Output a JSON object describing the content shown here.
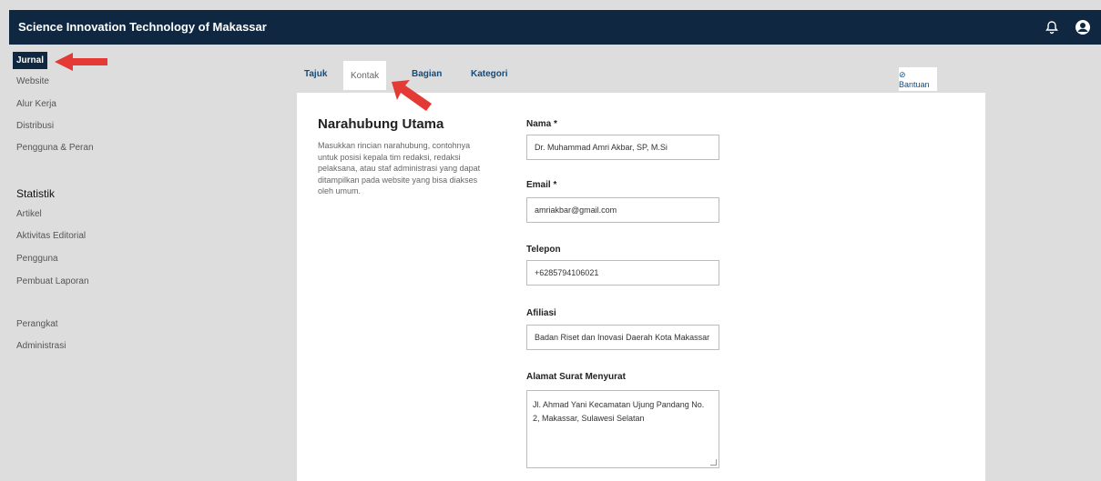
{
  "header": {
    "title": "Science Innovation Technology of Makassar",
    "icons": [
      "bell-icon",
      "user-icon"
    ]
  },
  "sidebar": {
    "items": [
      {
        "label": "Jurnal",
        "active": true
      },
      {
        "label": "Website"
      },
      {
        "label": "Alur Kerja"
      },
      {
        "label": "Distribusi"
      },
      {
        "label": "Pengguna & Peran"
      }
    ],
    "statistik_heading": "Statistik",
    "statistik_items": [
      "Artikel",
      "Aktivitas Editorial",
      "Pengguna",
      "Pembuat Laporan"
    ],
    "bottom_items": [
      "Perangkat",
      "Administrasi"
    ]
  },
  "tabs": [
    {
      "label": "Tajuk"
    },
    {
      "label": "Kontak",
      "active": true
    },
    {
      "label": "Bagian"
    },
    {
      "label": "Kategori"
    }
  ],
  "help_label": "⊘ Bantuan",
  "section": {
    "title": "Narahubung Utama",
    "description": "Masukkan rincian narahubung, contohnya untuk posisi kepala tim redaksi, redaksi pelaksana, atau staf administrasi yang dapat ditampilkan pada website yang bisa diakses oleh umum."
  },
  "fields": {
    "name": {
      "label": "Nama *",
      "value": "Dr. Muhammad Amri Akbar, SP, M.Si"
    },
    "email": {
      "label": "Email *",
      "value": "amriakbar@gmail.com"
    },
    "phone": {
      "label": "Telepon",
      "value": "+6285794106021"
    },
    "affiliation": {
      "label": "Afiliasi",
      "value": "Badan Riset dan Inovasi Daerah Kota Makassar"
    },
    "address": {
      "label": "Alamat Surat Menyurat",
      "value": "Jl. Ahmad Yani Kecamatan Ujung Pandang No. 2, Makassar, Sulawesi Selatan"
    }
  },
  "colors": {
    "header_bg": "#0f2740",
    "link": "#0f4c81",
    "arrow": "#e53935"
  }
}
